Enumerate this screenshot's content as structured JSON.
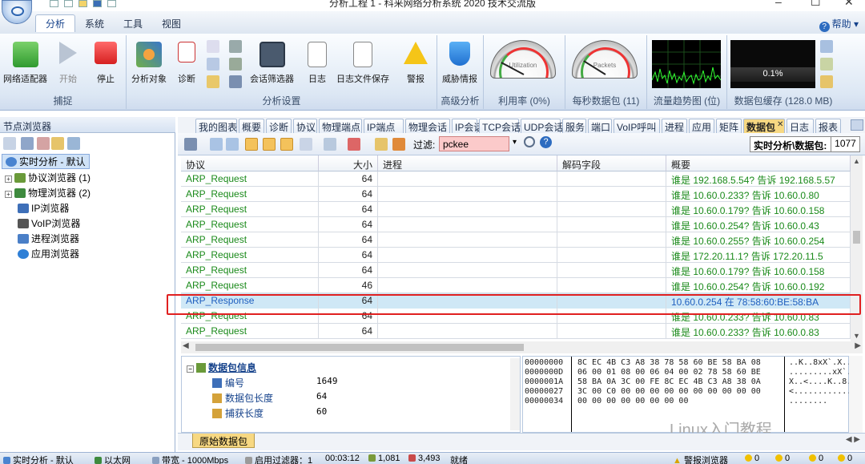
{
  "window": {
    "title": "分析工程 1 - 科来网络分析系统 2020 技术交流版",
    "minimize": "–",
    "maximize": "☐",
    "close": "✕"
  },
  "menu_tabs": [
    "分析",
    "系统",
    "工具",
    "视图"
  ],
  "help_label": "帮助",
  "ribbon": {
    "capture": {
      "label": "捕捉",
      "buttons": [
        "网络适配器",
        "开始",
        "停止"
      ]
    },
    "analysis_settings": {
      "label": "分析设置",
      "buttons": [
        "分析对象",
        "诊断",
        "会话筛选器",
        "日志",
        "日志文件保存",
        "警报"
      ]
    },
    "advanced": {
      "label": "高级分析",
      "buttons": [
        "威胁情报"
      ]
    },
    "utilization": {
      "label": "利用率 (0%)",
      "gauge_text": "Utilization",
      "value": 0
    },
    "packets": {
      "label": "每秒数据包 (11)",
      "gauge_text": "Packets",
      "value": 11
    },
    "trend": {
      "label": "流量趋势图 (位)"
    },
    "buffer": {
      "label": "数据包缓存 (128.0 MB)",
      "value": "0.1%"
    }
  },
  "left_panel": {
    "title": "节点浏览器",
    "tree": [
      {
        "label": "实时分析 - 默认",
        "selected": true
      },
      {
        "label": "协议浏览器 (1)",
        "expander": "+"
      },
      {
        "label": "物理浏览器 (2)",
        "expander": "+"
      },
      {
        "label": "IP浏览器"
      },
      {
        "label": "VoIP浏览器"
      },
      {
        "label": "进程浏览器"
      },
      {
        "label": "应用浏览器"
      }
    ]
  },
  "view_tabs": [
    "我的图表",
    "概要",
    "诊断",
    "协议",
    "物理端点",
    "IP端点",
    "物理会话",
    "IP会话",
    "TCP会话",
    "UDP会话",
    "服务",
    "端口",
    "VoIP呼叫",
    "进程",
    "应用",
    "矩阵",
    "数据包",
    "日志",
    "报表"
  ],
  "active_view_tab": "数据包",
  "toolbar": {
    "filter_label": "过滤:",
    "filter_value": "pckee",
    "realtime_label": "实时分析\\数据包:",
    "packet_count": "1077"
  },
  "packet_table": {
    "columns": [
      "协议",
      "大小",
      "进程",
      "解码字段",
      "概要"
    ],
    "rows": [
      {
        "protocol": "ARP_Request",
        "size": "64",
        "process": "",
        "decode": "",
        "summary": "谁是 192.168.5.54? 告诉 192.168.5.57",
        "color": "green"
      },
      {
        "protocol": "ARP_Request",
        "size": "64",
        "process": "",
        "decode": "",
        "summary": "谁是 10.60.0.233? 告诉 10.60.0.80",
        "color": "green"
      },
      {
        "protocol": "ARP_Request",
        "size": "64",
        "process": "",
        "decode": "",
        "summary": "谁是 10.60.0.179? 告诉 10.60.0.158",
        "color": "green"
      },
      {
        "protocol": "ARP_Request",
        "size": "64",
        "process": "",
        "decode": "",
        "summary": "谁是 10.60.0.254? 告诉 10.60.0.43",
        "color": "green"
      },
      {
        "protocol": "ARP_Request",
        "size": "64",
        "process": "",
        "decode": "",
        "summary": "谁是 10.60.0.255? 告诉 10.60.0.254",
        "color": "green"
      },
      {
        "protocol": "ARP_Request",
        "size": "64",
        "process": "",
        "decode": "",
        "summary": "谁是 172.20.11.1? 告诉 172.20.11.5",
        "color": "green"
      },
      {
        "protocol": "ARP_Request",
        "size": "64",
        "process": "",
        "decode": "",
        "summary": "谁是 10.60.0.179? 告诉 10.60.0.158",
        "color": "green"
      },
      {
        "protocol": "ARP_Request",
        "size": "46",
        "process": "",
        "decode": "",
        "summary": "谁是 10.60.0.254? 告诉 10.60.0.192",
        "color": "green"
      },
      {
        "protocol": "ARP_Response",
        "size": "64",
        "process": "",
        "decode": "",
        "summary": "10.60.0.254 在 78:58:60:BE:58:BA",
        "color": "blue",
        "selected": true
      },
      {
        "protocol": "ARP_Request",
        "size": "64",
        "process": "",
        "decode": "",
        "summary": "谁是 10.60.0.233? 告诉 10.60.0.83",
        "color": "green"
      },
      {
        "protocol": "ARP_Request",
        "size": "64",
        "process": "",
        "decode": "",
        "summary": "谁是 10.60.0.233? 告诉 10.60.0.83",
        "color": "green"
      }
    ]
  },
  "packet_info": {
    "title": "数据包信息",
    "fields": [
      {
        "name": "编号",
        "value": "1649"
      },
      {
        "name": "数据包长度",
        "value": "64"
      },
      {
        "name": "捕获长度",
        "value": "60"
      }
    ]
  },
  "hex_dump": {
    "offsets": [
      "00000000",
      "0000000D",
      "0000001A",
      "00000027",
      "00000034"
    ],
    "bytes": [
      "8C EC 4B C3 A8 38 78 58 60 BE 58 BA 08",
      "06 00 01 08 00 06 04 00 02 78 58 60 BE",
      "58 BA 0A 3C 00 FE 8C EC 4B C3 A8 38 0A",
      "3C 00 C0 00 00 00 00 00 00 00 00 00 00",
      "00 00 00 00 00 00 00 00"
    ],
    "ascii": [
      "..K..8xX`.X..",
      ".........xX`.",
      "X..<....K..8.",
      "<............",
      "........"
    ]
  },
  "bottom_tab": "原始数据包",
  "watermark": "Linux入门教程",
  "status_bar": {
    "mode": "实时分析 - 默认",
    "adapter": "以太网",
    "bandwidth": "带宽 - 1000Mbps",
    "filter": "启用过滤器：1",
    "time": "00:03:12",
    "count1": "1,081",
    "count2": "3,493",
    "status": "就绪",
    "alert_browser": "警报浏览器",
    "alert_counts": [
      "0",
      "0",
      "0",
      "0"
    ]
  }
}
